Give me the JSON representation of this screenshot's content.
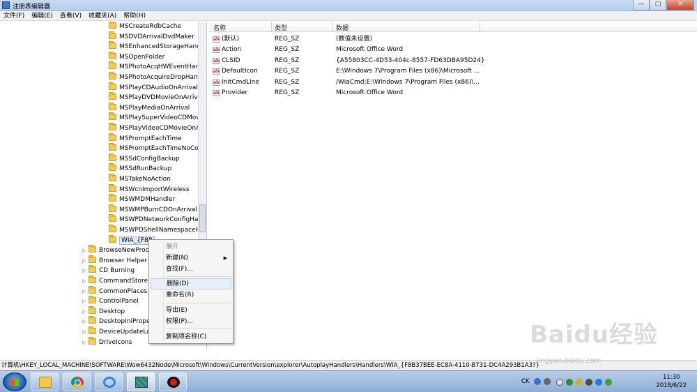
{
  "window": {
    "title": "注册表编辑器",
    "minimize_label": "—",
    "maximize_label": "□",
    "close_label": "✕"
  },
  "menu": [
    "文件(F)",
    "编辑(E)",
    "查看(V)",
    "收藏夹(A)",
    "帮助(H)"
  ],
  "tree": {
    "children": [
      "MSCreateRdbCache",
      "MSDVDArrivalDvdMaker",
      "MSEnhancedStorageHand",
      "MSOpenFolder",
      "MSPhotoAcqHWEventHan",
      "MSPhotoAcquireDropHan",
      "MSPlayCDAudioOnArrival",
      "MSPlayDVDMovieOnArriva",
      "MSPlayMediaOnArrival",
      "MSPlaySuperVideoCDMov",
      "MSPlayVideoCDMovieOnA",
      "MSPromptEachTime",
      "MSPromptEachTimeNoCo",
      "MSSdConfigBackup",
      "MSSdRunBackup",
      "MSTakeNoAction",
      "MSWcnImportWireless",
      "MSWMDMHandler",
      "MSWMPBurnCDOnArrival",
      "MSWPDNetworkConfigHa",
      "MSWPDShellNamespaceH",
      "WIA_{F8B"
    ],
    "siblings": [
      "BrowseNewProc",
      "Browser Helper",
      "CD Burning",
      "CommandStore",
      "CommonPlaces",
      "ControlPanel",
      "Desktop",
      "DesktopIniPrope",
      "DeviceUpdateLo",
      "DriveIcons"
    ]
  },
  "values": {
    "headers": {
      "name": "名称",
      "type": "类型",
      "data": "数据"
    },
    "rows": [
      {
        "name": "(默认)",
        "type": "REG_SZ",
        "data": "(数值未设置)"
      },
      {
        "name": "Action",
        "type": "REG_SZ",
        "data": "Microsoft Office Word"
      },
      {
        "name": "CLSID",
        "type": "REG_SZ",
        "data": "{A55803CC-4D53-404c-8557-FD63DBA95D24}"
      },
      {
        "name": "DefaultIcon",
        "type": "REG_SZ",
        "data": "E:\\Windows 7\\Program Files (x86)\\Microsoft ..."
      },
      {
        "name": "InitCmdLine",
        "type": "REG_SZ",
        "data": "/WiaCmd;E:\\Windows 7\\Program Files (x86)\\..."
      },
      {
        "name": "Provider",
        "type": "REG_SZ",
        "data": "Microsoft Office Word"
      }
    ],
    "icon_glyph": "ab"
  },
  "context_menu": [
    {
      "label": "展开",
      "disabled": true
    },
    {
      "label": "新建(N)",
      "submenu": true
    },
    {
      "label": "查找(F)..."
    },
    {
      "label": "删除(D)",
      "hover": true
    },
    {
      "label": "重命名(R)"
    },
    {
      "label": "导出(E)"
    },
    {
      "label": "权限(P)..."
    },
    {
      "label": "复制项名称(C)"
    }
  ],
  "submenu_arrow": "▶",
  "status_bar": "计算机\\HKEY_LOCAL_MACHINE\\SOFTWARE\\Wow6432Node\\Microsoft\\Windows\\CurrentVersion\\explorer\\AutoplayHandlers\\Handlers\\WIA_{F8B37BEE-EC8A-4110-B731-DC4A293B1A3?}",
  "taskbar": {
    "apps": [
      "file-explorer",
      "chrome",
      "baidu-netdisk",
      "regedit",
      "screen-recorder"
    ],
    "tray": {
      "lang": "CK",
      "time": "11:30",
      "date": "2018/6/22"
    }
  },
  "watermark": {
    "text": "Baidu经验",
    "url": "jingyan.baidu.com"
  },
  "colors": {
    "titlebar": "#c9dcf2",
    "taskbar": "#9db9dd",
    "folder": "#f0cd5a",
    "hover": "#e8eff9"
  }
}
